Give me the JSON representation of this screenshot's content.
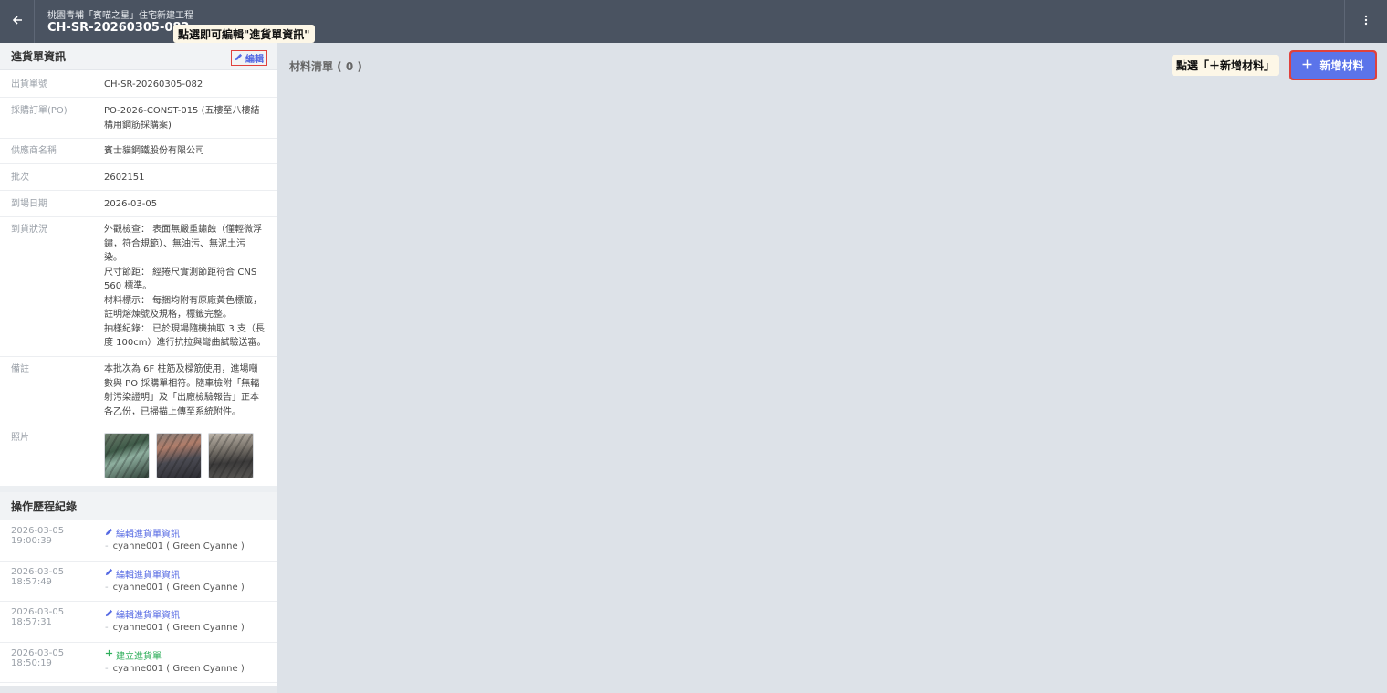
{
  "header": {
    "back_icon": "arrow-left-icon",
    "project_name": "桃園青埔「賓喵之星」住宅新建工程",
    "doc_number": "CH-SR-20260305-082",
    "more_icon": "more-vertical-icon"
  },
  "callouts": {
    "edit_hint": "點選即可編輯\"進貨單資訊\"",
    "add_hint": "點選「＋新增材料」"
  },
  "info_section": {
    "title": "進貨單資訊",
    "edit_label": "編輯",
    "rows": [
      {
        "label": "出貨單號",
        "value": "CH-SR-20260305-082"
      },
      {
        "label": "採購訂單(PO)",
        "value": "PO-2026-CONST-015 (五樓至八樓結構用鋼筋採購案)"
      },
      {
        "label": "供應商名稱",
        "value": "賓士貓鋼鐵股份有限公司"
      },
      {
        "label": "批次",
        "value": "2602151"
      },
      {
        "label": "到場日期",
        "value": "2026-03-05"
      },
      {
        "label": "到貨狀況",
        "lines": [
          "外觀檢查： 表面無嚴重鏽蝕（僅輕微浮",
          "鏽，符合規範）、無油污、無泥土污",
          "染。",
          "尺寸節距： 經捲尺實測節距符合 CNS",
          "560 標準。",
          "材料標示： 每捆均附有原廠黃色標籤，",
          "註明熔煉號及規格，標籤完整。",
          "抽樣紀錄： 已於現場隨機抽取 3 支（長",
          "度 100cm）進行抗拉與彎曲試驗送審。"
        ]
      },
      {
        "label": "備註",
        "lines": [
          "本批次為 6F 柱筋及樑筋使用，進場噸",
          "數與 PO 採購單相符。隨車檢附「無輻",
          "射污染證明」及「出廠檢驗報告」正本",
          "各乙份，已掃描上傳至系統附件。"
        ]
      },
      {
        "label": "照片"
      }
    ]
  },
  "history_section": {
    "title": "操作歷程紀錄",
    "entries": [
      {
        "time": "2026-03-05 19:00:39",
        "action": "編輯進貨單資訊",
        "type": "edit",
        "user": "cyanne001 ( Green Cyanne )"
      },
      {
        "time": "2026-03-05 18:57:49",
        "action": "編輯進貨單資訊",
        "type": "edit",
        "user": "cyanne001 ( Green Cyanne )"
      },
      {
        "time": "2026-03-05 18:57:31",
        "action": "編輯進貨單資訊",
        "type": "edit",
        "user": "cyanne001 ( Green Cyanne )"
      },
      {
        "time": "2026-03-05 18:50:19",
        "action": "建立進貨單",
        "type": "create",
        "user": "cyanne001 ( Green Cyanne )"
      }
    ]
  },
  "materials": {
    "title": "材料清單 ( 0 )",
    "add_label": "新增材料",
    "add_icon": "plus-icon"
  },
  "colors": {
    "header_bg": "#4a5361",
    "accent": "#5b74ea",
    "highlight_border": "#e0413c",
    "create_green": "#2eae5a"
  }
}
